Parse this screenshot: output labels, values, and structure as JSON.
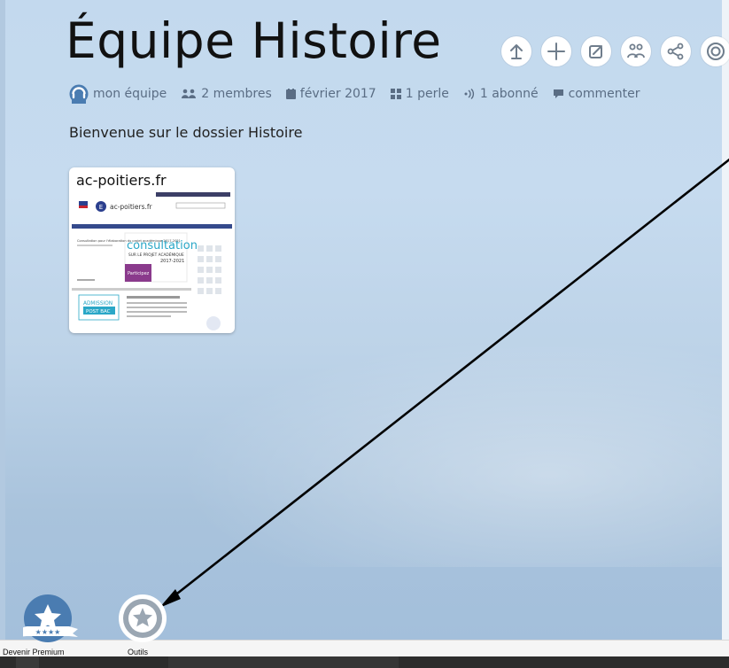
{
  "folder": {
    "title": "Équipe Histoire",
    "description": "Bienvenue sur le dossier Histoire"
  },
  "meta": {
    "team": "mon équipe",
    "members": "2 membres",
    "date": "février 2017",
    "pearls": "1 perle",
    "subscribers": "1 abonné",
    "comment": "commenter"
  },
  "title_actions": [
    "up-icon",
    "plus-icon",
    "edit-icon",
    "members-icon",
    "share-icon",
    "target-icon"
  ],
  "pearl_card": {
    "title": "ac-poitiers.fr",
    "thumbnail": {
      "site_name": "ac-poitiers.fr",
      "headline": "consultation",
      "subheadline": "SUR LE PROJET ACADÉMIQUE",
      "years": "2017-2021",
      "side_text": "Consultation pour l'élaboration du projet académique 2017-2021",
      "cta": "Participez",
      "admission": "ADMISSION",
      "post_bac": "POST BAC"
    }
  },
  "bottom_bar": {
    "premium_label": "Devenir Premium",
    "tools_label": "Outils"
  },
  "colors": {
    "meta_text": "#5a6d84",
    "premium_blue": "#4a7cb1",
    "tools_gray": "#9aa6b2",
    "arrow": "#000000"
  }
}
